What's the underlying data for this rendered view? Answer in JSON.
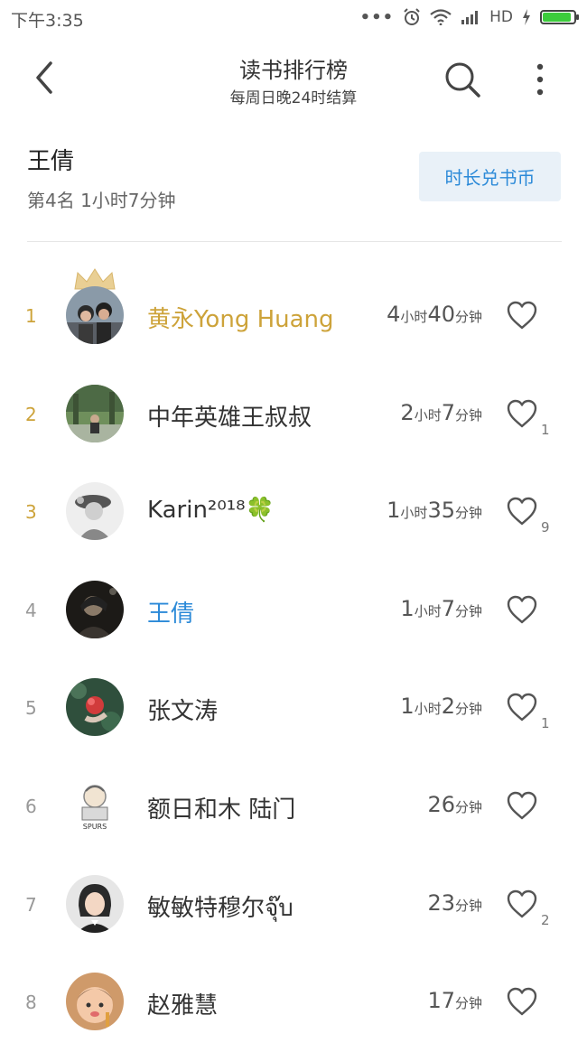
{
  "status_bar": {
    "time": "下午3:35",
    "dots": "•••",
    "network": "HD",
    "battery_level": 0.9
  },
  "header": {
    "title": "读书排行榜",
    "subtitle": "每周日晚24时结算"
  },
  "me": {
    "name": "王倩",
    "rank_text": "第4名 1小时7分钟",
    "exchange_button": "时长兑书币"
  },
  "ranking": [
    {
      "rank": "1",
      "name": "黄永Yong Huang",
      "hours": "4",
      "hours_unit": "小时",
      "minutes": "40",
      "minutes_unit": "分钟",
      "likes": "",
      "highlight": "gold"
    },
    {
      "rank": "2",
      "name": "中年英雄王叔叔",
      "hours": "2",
      "hours_unit": "小时",
      "minutes": "7",
      "minutes_unit": "分钟",
      "likes": "1",
      "highlight": ""
    },
    {
      "rank": "3",
      "name": "Karin²⁰¹⁸🍀",
      "hours": "1",
      "hours_unit": "小时",
      "minutes": "35",
      "minutes_unit": "分钟",
      "likes": "9",
      "highlight": ""
    },
    {
      "rank": "4",
      "name": "王倩",
      "hours": "1",
      "hours_unit": "小时",
      "minutes": "7",
      "minutes_unit": "分钟",
      "likes": "",
      "highlight": "blue"
    },
    {
      "rank": "5",
      "name": "张文涛",
      "hours": "1",
      "hours_unit": "小时",
      "minutes": "2",
      "minutes_unit": "分钟",
      "likes": "1",
      "highlight": ""
    },
    {
      "rank": "6",
      "name": "额日和木 陆门",
      "hours": "",
      "hours_unit": "",
      "minutes": "26",
      "minutes_unit": "分钟",
      "likes": "",
      "highlight": ""
    },
    {
      "rank": "7",
      "name": "敏敏特穆尔จุ๊บ",
      "hours": "",
      "hours_unit": "",
      "minutes": "23",
      "minutes_unit": "分钟",
      "likes": "2",
      "highlight": ""
    },
    {
      "rank": "8",
      "name": "赵雅慧",
      "hours": "",
      "hours_unit": "",
      "minutes": "17",
      "minutes_unit": "分钟",
      "likes": "",
      "highlight": ""
    }
  ],
  "colors": {
    "gold": "#cda33a",
    "blue": "#2c8ad8",
    "button_bg": "#e9f1f8"
  }
}
